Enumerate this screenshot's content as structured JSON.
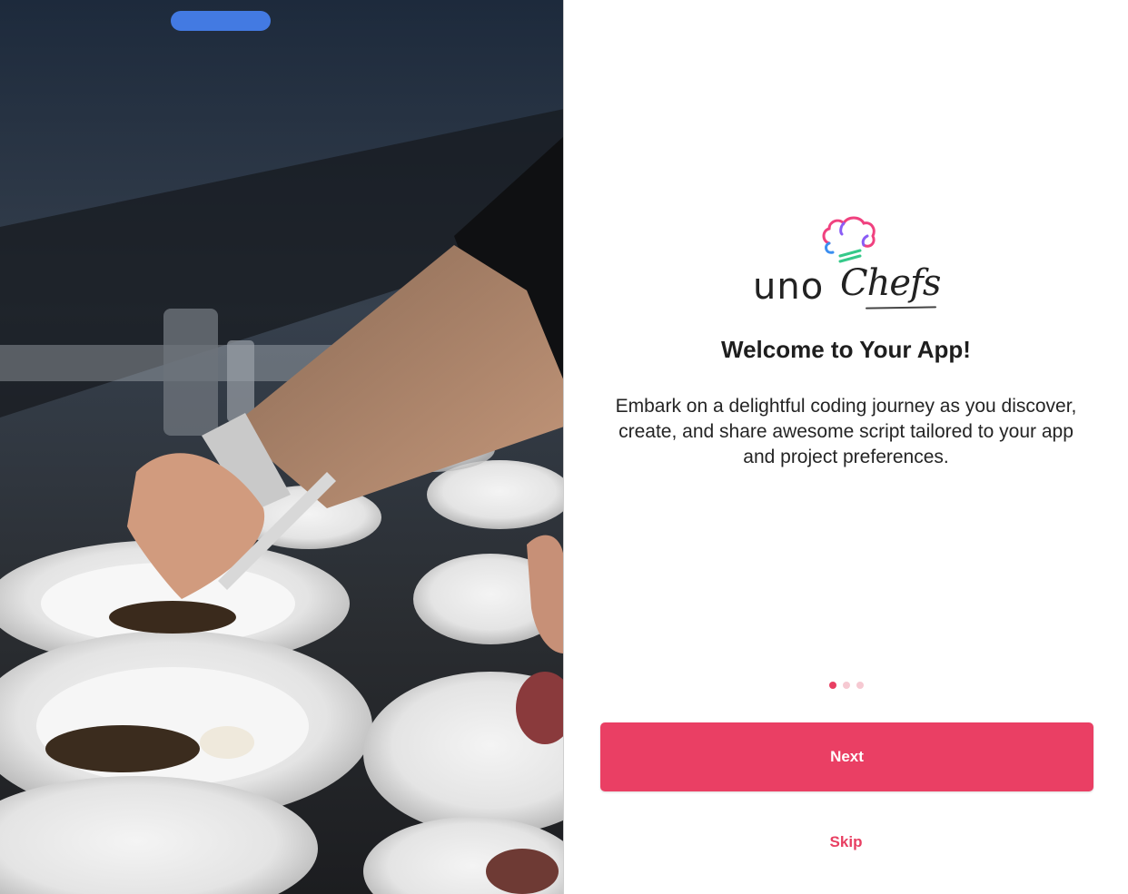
{
  "hero": {
    "image": "chef-plating-food-photo"
  },
  "logo": {
    "word": "uno",
    "script": "Chefs",
    "icon": "chef-hat-icon"
  },
  "welcome": {
    "title": "Welcome to Your App!",
    "description": "Embark on a delightful coding journey as you discover, create, and share awesome script tailored to your app and project preferences."
  },
  "pager": {
    "total": 3,
    "current": 1
  },
  "actions": {
    "next_label": "Next",
    "skip_label": "Skip"
  },
  "colors": {
    "accent": "#ea3f64",
    "dot_inactive": "#f6c9d2",
    "hat_pink": "#f0417f",
    "hat_purple": "#8a5cf5",
    "hat_blue": "#3b8ef0",
    "hat_green": "#35c98a"
  }
}
